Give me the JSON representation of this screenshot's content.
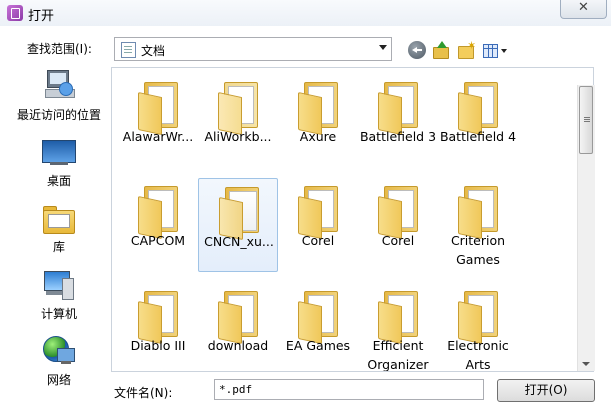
{
  "window": {
    "title": "打开",
    "close_label": "✕"
  },
  "lookin": {
    "label": "查找范围(I):",
    "value": "文档"
  },
  "toolbar": {
    "back": "back-icon",
    "up": "up-folder-icon",
    "new_folder": "new-folder-icon",
    "views": "view-menu-icon"
  },
  "places": [
    {
      "label": "最近访问的位置",
      "icon": "recent-places-icon"
    },
    {
      "label": "桌面",
      "icon": "desktop-icon"
    },
    {
      "label": "库",
      "icon": "libraries-icon"
    },
    {
      "label": "计算机",
      "icon": "computer-icon"
    },
    {
      "label": "网络",
      "icon": "network-icon"
    }
  ],
  "files": [
    {
      "name": "AlawarWr...",
      "type": "folder"
    },
    {
      "name": "AliWorkb...",
      "type": "folder-empty"
    },
    {
      "name": "Axure",
      "type": "folder"
    },
    {
      "name": "Battlefield 3",
      "type": "folder"
    },
    {
      "name": "Battlefield 4",
      "type": "folder"
    },
    {
      "name": "CAPCOM",
      "type": "folder"
    },
    {
      "name": "CNCN_xu...",
      "type": "folder-doc",
      "selected": true
    },
    {
      "name": "Corel",
      "type": "folder"
    },
    {
      "name": "Corel",
      "type": "folder"
    },
    {
      "name": "Criterion Games",
      "type": "folder"
    },
    {
      "name": "Diablo III",
      "type": "folder"
    },
    {
      "name": "download",
      "type": "folder"
    },
    {
      "name": "EA Games",
      "type": "folder"
    },
    {
      "name": "Efficient Organizer",
      "type": "folder"
    },
    {
      "name": "Electronic Arts",
      "type": "folder"
    }
  ],
  "filename": {
    "label": "文件名(N):",
    "value": "*.pdf"
  },
  "open_button": {
    "label": "打开(O)"
  },
  "colors": {
    "folder": "#f0c85a",
    "selection": "#e4eefb",
    "titlebar": "#ecf1f7"
  }
}
